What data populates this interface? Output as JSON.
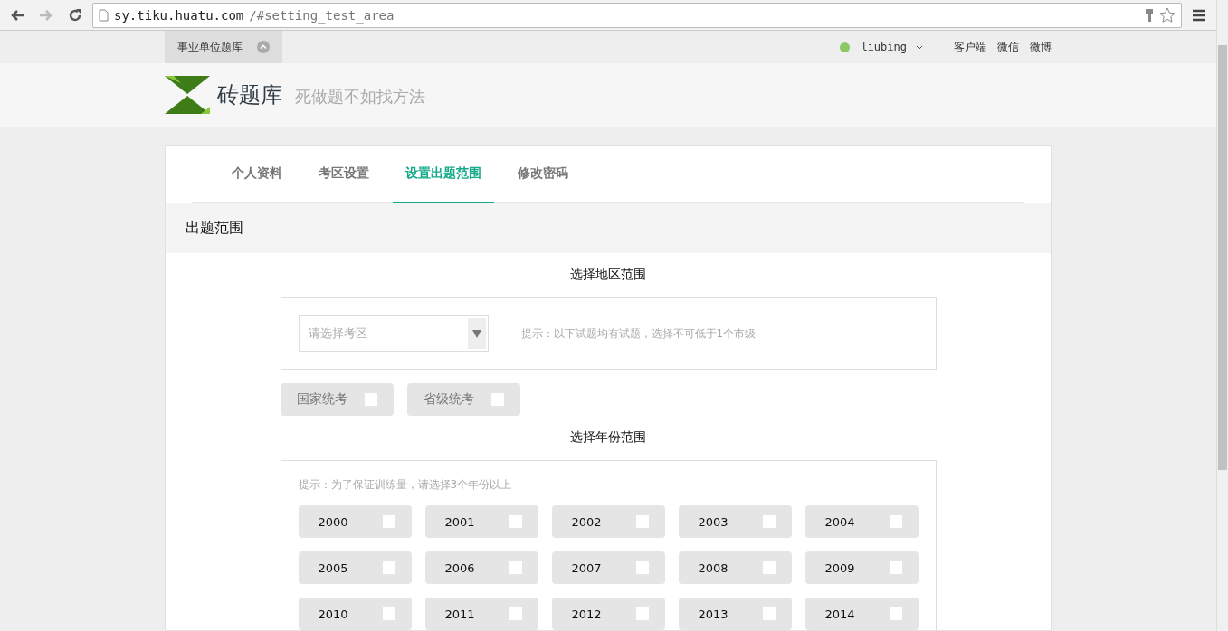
{
  "browser": {
    "url_host": "sy.tiku.huatu.com",
    "url_path": "/#setting_test_area"
  },
  "topbar": {
    "bank": "事业单位题库",
    "user": "liubing",
    "online": true,
    "links": [
      "客户端",
      "微信",
      "微博"
    ]
  },
  "header": {
    "logo": "砖题库",
    "slogan": "死做题不如找方法"
  },
  "tabs": [
    {
      "label": "个人资料",
      "selected": false
    },
    {
      "label": "考区设置",
      "selected": false
    },
    {
      "label": "设置出题范围",
      "selected": true
    },
    {
      "label": "修改密码",
      "selected": false
    }
  ],
  "section_title": "出题范围",
  "region": {
    "title": "选择地区范围",
    "select": {
      "placeholder": "请选择考区"
    },
    "hint": "提示：以下试题均有试题，选择不可低于1个市级",
    "options": [
      {
        "label": "国家统考",
        "checked": false
      },
      {
        "label": "省级统考",
        "checked": false
      }
    ]
  },
  "years": {
    "title": "选择年份范围",
    "hint": "提示：为了保证训练量，请选择3个年份以上",
    "items": [
      {
        "label": "2000",
        "checked": false
      },
      {
        "label": "2001",
        "checked": false
      },
      {
        "label": "2002",
        "checked": false
      },
      {
        "label": "2003",
        "checked": false
      },
      {
        "label": "2004",
        "checked": false
      },
      {
        "label": "2005",
        "checked": false
      },
      {
        "label": "2006",
        "checked": false
      },
      {
        "label": "2007",
        "checked": false
      },
      {
        "label": "2008",
        "checked": false
      },
      {
        "label": "2009",
        "checked": false
      },
      {
        "label": "2010",
        "checked": false
      },
      {
        "label": "2011",
        "checked": false
      },
      {
        "label": "2012",
        "checked": false
      },
      {
        "label": "2013",
        "checked": false
      },
      {
        "label": "2014",
        "checked": false
      }
    ]
  }
}
